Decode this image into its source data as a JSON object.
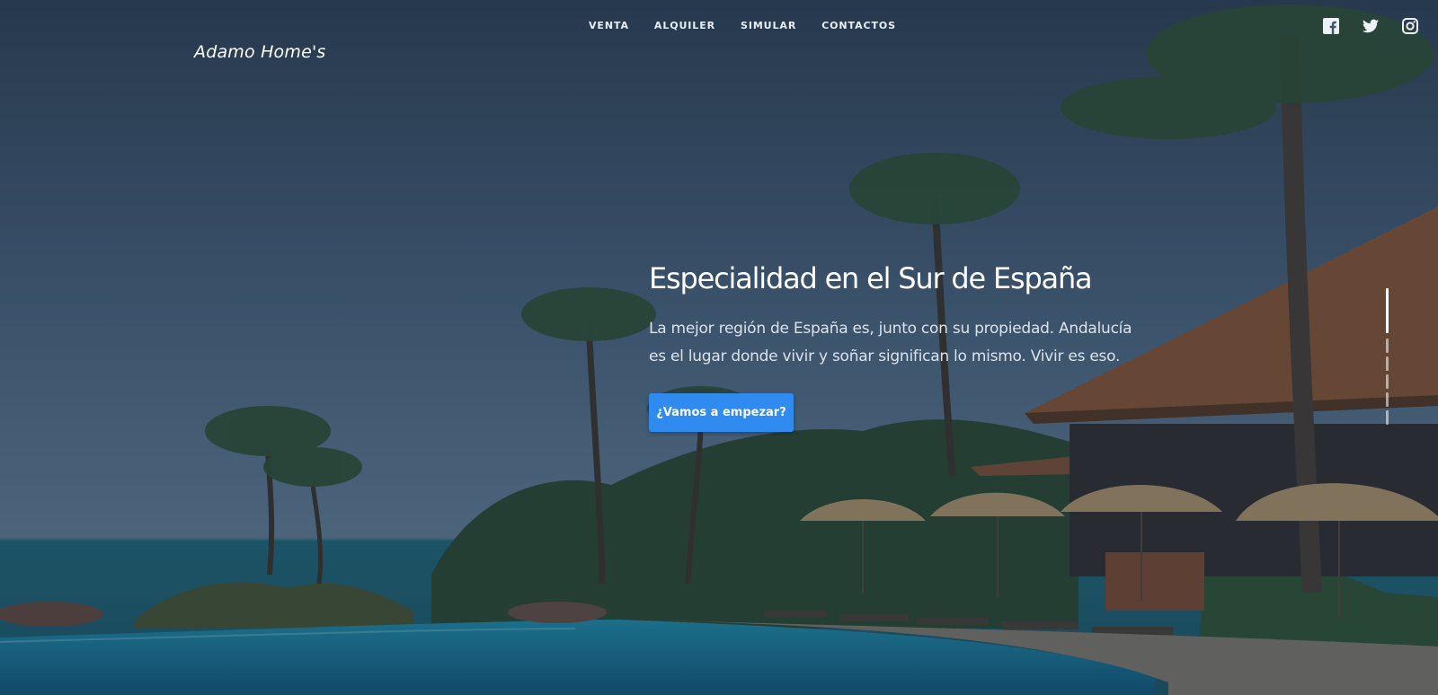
{
  "brand": {
    "logo": "Adamo Home's"
  },
  "nav": {
    "items": [
      {
        "label": "VENTA"
      },
      {
        "label": "ALQUILER"
      },
      {
        "label": "SIMULAR"
      },
      {
        "label": "CONTACTOS"
      }
    ]
  },
  "social": [
    {
      "icon": "facebook-icon"
    },
    {
      "icon": "twitter-icon"
    },
    {
      "icon": "instagram-icon"
    }
  ],
  "hero": {
    "title": "Especialidad en el Sur de España",
    "subtitle": "La mejor región de España es, junto con su propiedad. Andalucía es el lugar donde vivir y soñar significan lo mismo. Vivir es eso.",
    "cta_label": "¿Vamos a empezar?"
  },
  "slider": {
    "count": 6,
    "active": 1
  },
  "colors": {
    "accent": "#2f8bf0",
    "overlay": "#1e2d40"
  }
}
